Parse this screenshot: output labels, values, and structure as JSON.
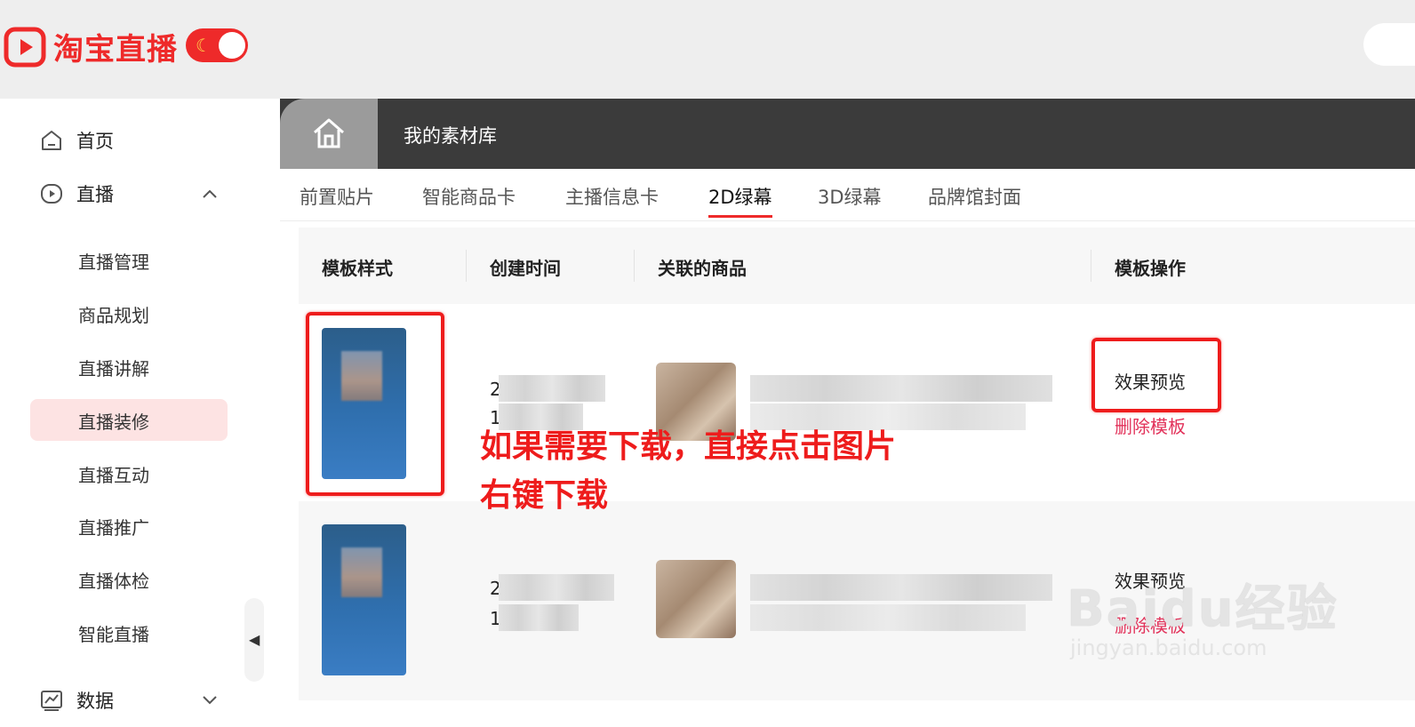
{
  "brand": {
    "name": "淘宝直播",
    "color": "#ee2a2a"
  },
  "sidebar": {
    "items": [
      {
        "label": "首页",
        "icon": "home-icon"
      },
      {
        "label": "直播",
        "icon": "play-icon",
        "expanded": true
      },
      {
        "label": "数据",
        "icon": "chart-icon",
        "expanded": false
      }
    ],
    "sub_items": [
      "直播管理",
      "商品规划",
      "直播讲解",
      "直播装修",
      "直播互动",
      "直播推广",
      "直播体检",
      "智能直播"
    ],
    "active_sub_item": "直播装修"
  },
  "tabbar": {
    "title": "我的素材库"
  },
  "subtabs": {
    "items": [
      "前置贴片",
      "智能商品卡",
      "主播信息卡",
      "2D绿幕",
      "3D绿幕",
      "品牌馆封面"
    ],
    "active": "2D绿幕"
  },
  "table": {
    "columns": [
      "模板样式",
      "创建时间",
      "关联的商品",
      "模板操作"
    ],
    "rows": [
      {
        "time_line1": "2",
        "time_line2": "1",
        "preview_label": "效果预览",
        "delete_label": "删除模板"
      },
      {
        "time_line1": "2",
        "time_line2": "1",
        "preview_label": "效果预览",
        "delete_label": "删除模板"
      }
    ]
  },
  "annotation": {
    "line1": "如果需要下载，直接点击图片",
    "line2": "右键下载",
    "color": "#ee1c1c"
  },
  "watermark": {
    "main": "Baidu经验",
    "sub": "jingyan.baidu.com"
  }
}
